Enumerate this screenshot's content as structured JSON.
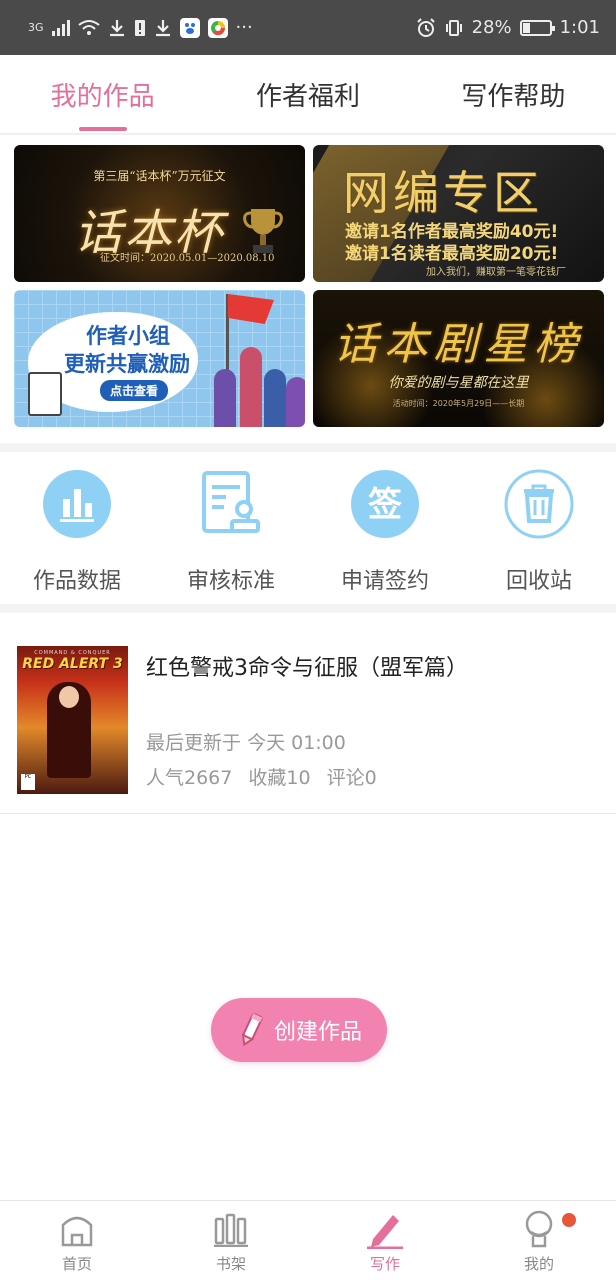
{
  "status_bar": {
    "network": "3G",
    "more": "···",
    "battery_percent": "28%",
    "battery_level": 0.28,
    "time": "1:01"
  },
  "tabs": [
    {
      "label": "我的作品",
      "active": true
    },
    {
      "label": "作者福利",
      "active": false
    },
    {
      "label": "写作帮助",
      "active": false
    }
  ],
  "banners": {
    "huaben_cup": {
      "headline": "第三届“话本杯”万元征文",
      "title": "话本杯",
      "dates": "征文时间：2020.05.01—2020.08.10"
    },
    "web_editor": {
      "title": "网编专区",
      "line1": "邀请1名作者最高奖励40元!",
      "line2": "邀请1名读者最高奖励20元!",
      "footer": "加入我们，赚取第一笔零花钱厂"
    },
    "author_group": {
      "line1": "作者小组",
      "line2": "更新共赢激励",
      "button": "点击查看"
    },
    "drama_star": {
      "title": "话本剧星榜",
      "subtitle": "你爱的剧与星都在这里",
      "footer": "活动时间：2020年5月29日——长期"
    }
  },
  "actions": [
    {
      "label": "作品数据",
      "icon": "bar-chart-icon"
    },
    {
      "label": "审核标准",
      "icon": "review-doc-icon"
    },
    {
      "label": "申请签约",
      "icon": "sign-icon"
    },
    {
      "label": "回收站",
      "icon": "trash-icon"
    }
  ],
  "work": {
    "title": "红色警戒3命令与征服（盟军篇）",
    "cover_brand": "COMMAND & CONQUER",
    "cover_title": "RED ALERT 3",
    "cover_platform": "PC",
    "last_update_label": "最后更新于",
    "last_update_value": "今天 01:00",
    "popularity": "人气2667",
    "favorites": "收藏10",
    "comments": "评论0"
  },
  "create_button": {
    "label": "创建作品",
    "icon": "pencil-icon"
  },
  "bottom_nav": [
    {
      "label": "首页",
      "icon": "home-icon",
      "active": false
    },
    {
      "label": "书架",
      "icon": "bookshelf-icon",
      "active": false
    },
    {
      "label": "写作",
      "icon": "write-icon",
      "active": true
    },
    {
      "label": "我的",
      "icon": "profile-icon",
      "active": false,
      "badge": true
    }
  ],
  "colors": {
    "accent": "#e46f9b",
    "create_button": "#f283b0",
    "icon_blue": "#8fd0f5",
    "badge": "#e8563a",
    "status_bar": "#4a4a4a"
  }
}
